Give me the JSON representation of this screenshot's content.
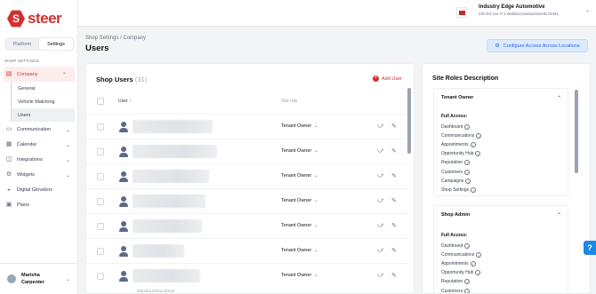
{
  "brand": {
    "name": "steer",
    "color": "#d32f2f"
  },
  "sidebar": {
    "toggle": {
      "platform": "Platform",
      "settings": "Settings"
    },
    "section_label": "SHOP SETTINGS",
    "company": "Company",
    "sub": [
      "General",
      "Vehicle Matching",
      "Users"
    ],
    "items": [
      {
        "label": "Communication",
        "icon": "chat-icon"
      },
      {
        "label": "Calendar",
        "icon": "calendar-icon"
      },
      {
        "label": "Integrations",
        "icon": "integrations-icon"
      },
      {
        "label": "Widgets",
        "icon": "widgets-icon"
      },
      {
        "label": "Digital Glovebox",
        "icon": "car-icon"
      },
      {
        "label": "Plans",
        "icon": "plans-icon"
      }
    ],
    "user": {
      "first": "Marisha",
      "last": "Carpenter"
    }
  },
  "topbar": {
    "location_name": "Industry Edge Automotive",
    "location_address": "230 3rd Ave Fl 3 Waltham Massachusetts 02451"
  },
  "header": {
    "breadcrumb": "Shop Settings / Company",
    "title": "Users",
    "config_button": "Configure Access Across Locations"
  },
  "users_card": {
    "title": "Shop Users",
    "count": "(31)",
    "add_user": "Add User",
    "col_user": "User",
    "col_role": "Site role",
    "rows": [
      {
        "role": "Tenant Owner"
      },
      {
        "role": "Tenant Owner"
      },
      {
        "role": "Tenant Owner"
      },
      {
        "role": "Tenant Owner"
      },
      {
        "role": "Tenant Owner"
      },
      {
        "role": "Tenant Owner"
      },
      {
        "role": "Tenant Owner"
      }
    ],
    "partial_row": "Marisha Demo Email"
  },
  "roles_card": {
    "title": "Site Roles Description",
    "full_access": "Full Access:",
    "roles": [
      {
        "name": "Tenant Owner",
        "perms": [
          "Dashboard",
          "Communications",
          "Appointments",
          "Opportunity Hub",
          "Reputation",
          "Customers",
          "Campaigns",
          "Shop Settings"
        ]
      },
      {
        "name": "Shop Admin",
        "perms": [
          "Dashboard",
          "Communications",
          "Appointments",
          "Opportunity Hub",
          "Reputation",
          "Customers"
        ]
      }
    ]
  }
}
